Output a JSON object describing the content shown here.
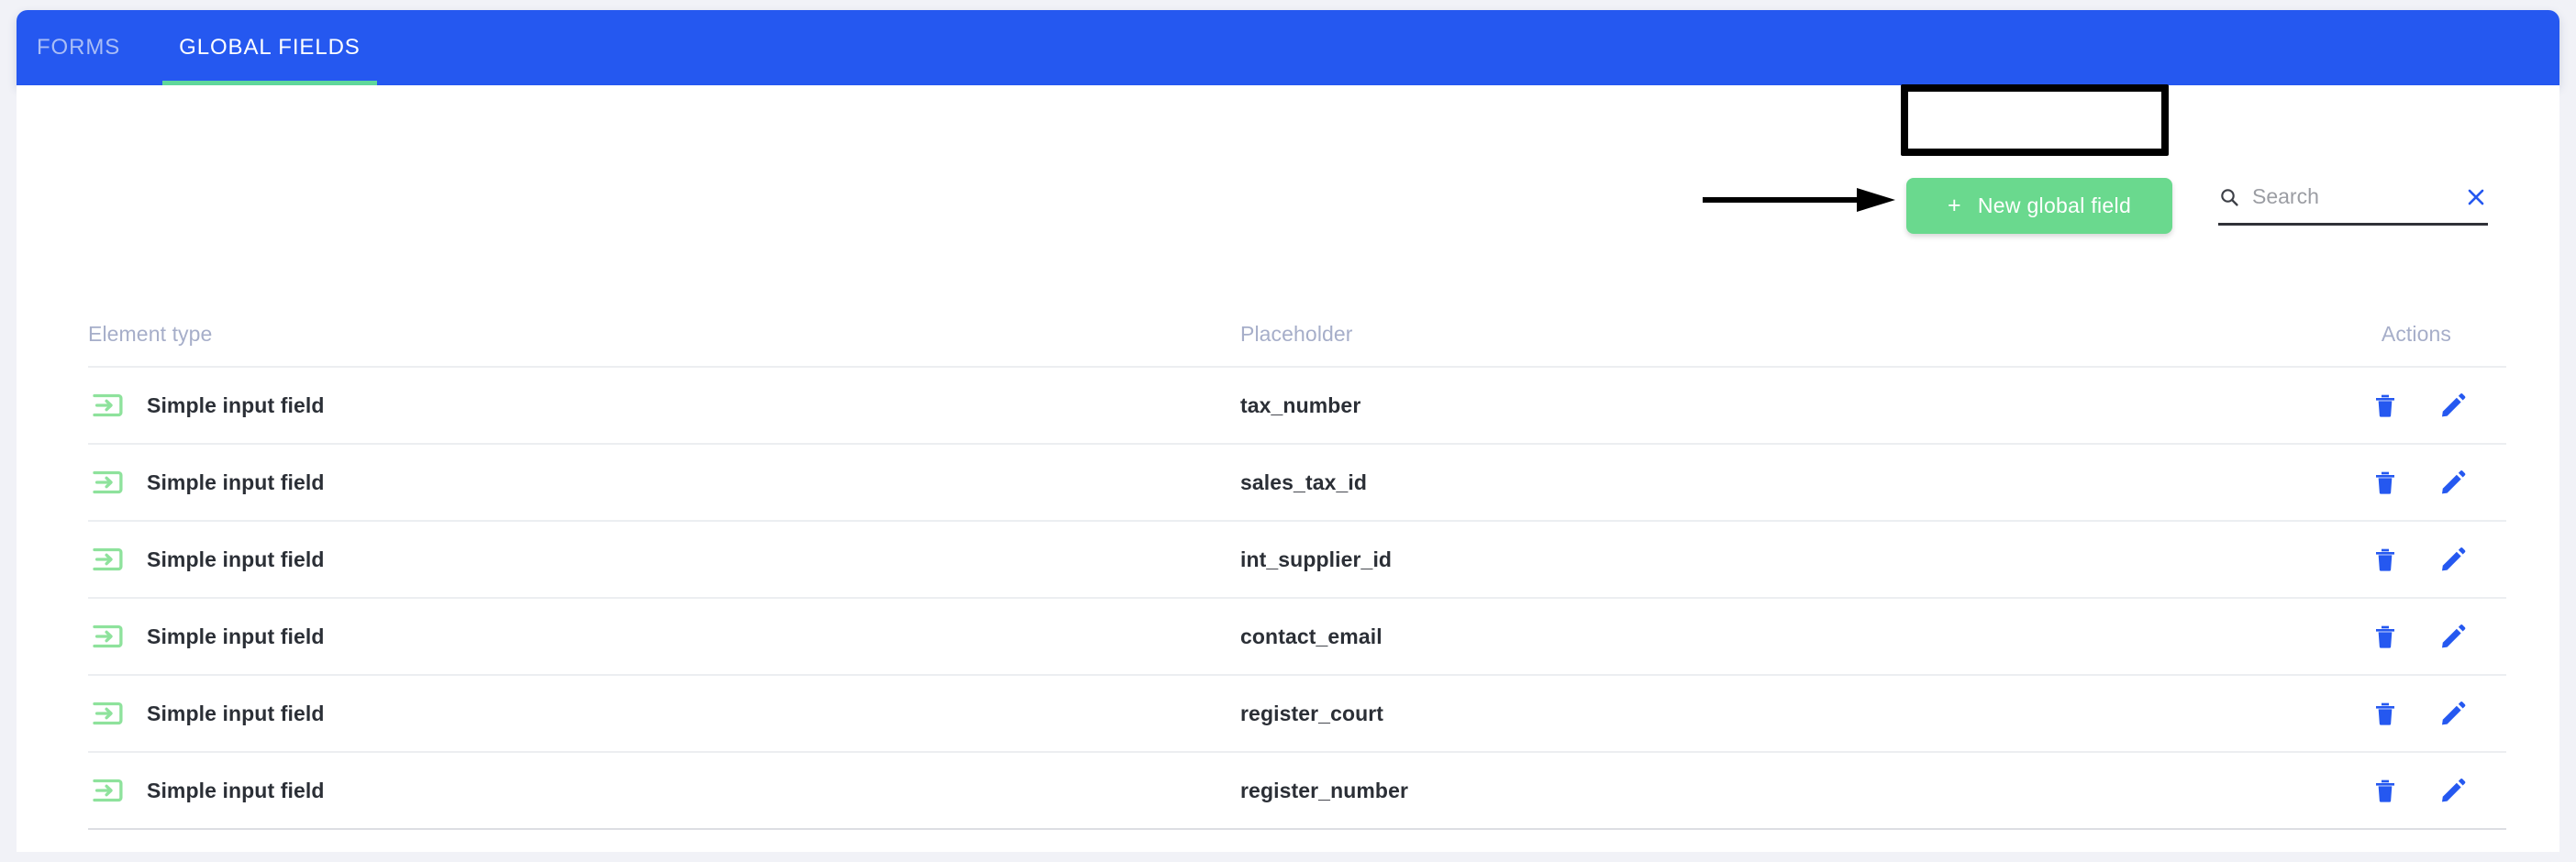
{
  "topbar": {
    "tabs": [
      {
        "label": "FORMS",
        "active": false
      },
      {
        "label": "GLOBAL FIELDS",
        "active": true
      }
    ],
    "bar_color": "#2558f0",
    "active_underline_color": "#5fd79a",
    "inactive_tab_color": "#a9bdf6"
  },
  "toolbar": {
    "new_global_field_label": "New global field",
    "new_global_field_plus": "+",
    "new_global_field_color": "#6ad98e",
    "annotation": {
      "box_color": "#000000",
      "arrow_color": "#000000"
    }
  },
  "search": {
    "value": "",
    "placeholder": "Search",
    "icon": "search-icon",
    "clear_icon": "close-icon",
    "clear_color": "#2558f0"
  },
  "table": {
    "columns": [
      "Element type",
      "Placeholder",
      "Actions"
    ],
    "rows": [
      {
        "icon": "input-field-icon",
        "type": "Simple input field",
        "placeholder": "tax_number",
        "actions": [
          "delete-icon",
          "edit-icon"
        ]
      },
      {
        "icon": "input-field-icon",
        "type": "Simple input field",
        "placeholder": "sales_tax_id",
        "actions": [
          "delete-icon",
          "edit-icon"
        ]
      },
      {
        "icon": "input-field-icon",
        "type": "Simple input field",
        "placeholder": "int_supplier_id",
        "actions": [
          "delete-icon",
          "edit-icon"
        ]
      },
      {
        "icon": "input-field-icon",
        "type": "Simple input field",
        "placeholder": "contact_email",
        "actions": [
          "delete-icon",
          "edit-icon"
        ]
      },
      {
        "icon": "input-field-icon",
        "type": "Simple input field",
        "placeholder": "register_court",
        "actions": [
          "delete-icon",
          "edit-icon"
        ]
      },
      {
        "icon": "input-field-icon",
        "type": "Simple input field",
        "placeholder": "register_number",
        "actions": [
          "delete-icon",
          "edit-icon"
        ]
      }
    ],
    "icon_color": "#8ee29c",
    "action_icon_color": "#2558f0",
    "header_color": "#a6aec9"
  },
  "theme": {
    "page_background": "#f1f2f7",
    "sheet_background": "#ffffff",
    "text_color": "#2b2f36"
  }
}
